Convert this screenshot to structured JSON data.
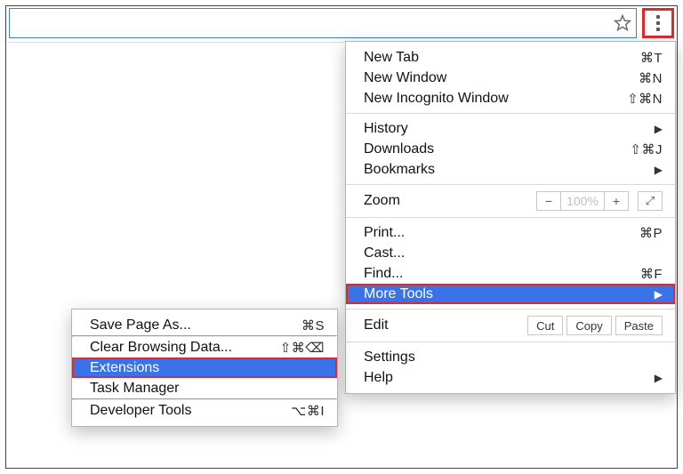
{
  "urlbar": {
    "value": ""
  },
  "menu": {
    "newTab": {
      "label": "New Tab",
      "shortcut": "⌘T"
    },
    "newWindow": {
      "label": "New Window",
      "shortcut": "⌘N"
    },
    "newIncognito": {
      "label": "New Incognito Window",
      "shortcut": "⇧⌘N"
    },
    "history": {
      "label": "History"
    },
    "downloads": {
      "label": "Downloads",
      "shortcut": "⇧⌘J"
    },
    "bookmarks": {
      "label": "Bookmarks"
    },
    "zoom": {
      "label": "Zoom",
      "minus": "−",
      "value": "100%",
      "plus": "+"
    },
    "print": {
      "label": "Print...",
      "shortcut": "⌘P"
    },
    "cast": {
      "label": "Cast..."
    },
    "find": {
      "label": "Find...",
      "shortcut": "⌘F"
    },
    "moreTools": {
      "label": "More Tools"
    },
    "edit": {
      "label": "Edit",
      "cut": "Cut",
      "copy": "Copy",
      "paste": "Paste"
    },
    "settings": {
      "label": "Settings"
    },
    "help": {
      "label": "Help"
    }
  },
  "submenu": {
    "savePageAs": {
      "label": "Save Page As...",
      "shortcut": "⌘S"
    },
    "clearBrowsing": {
      "label": "Clear Browsing Data...",
      "shortcut": "⇧⌘⌫"
    },
    "extensions": {
      "label": "Extensions"
    },
    "taskManager": {
      "label": "Task Manager"
    },
    "developerTools": {
      "label": "Developer Tools",
      "shortcut": "⌥⌘I"
    }
  }
}
